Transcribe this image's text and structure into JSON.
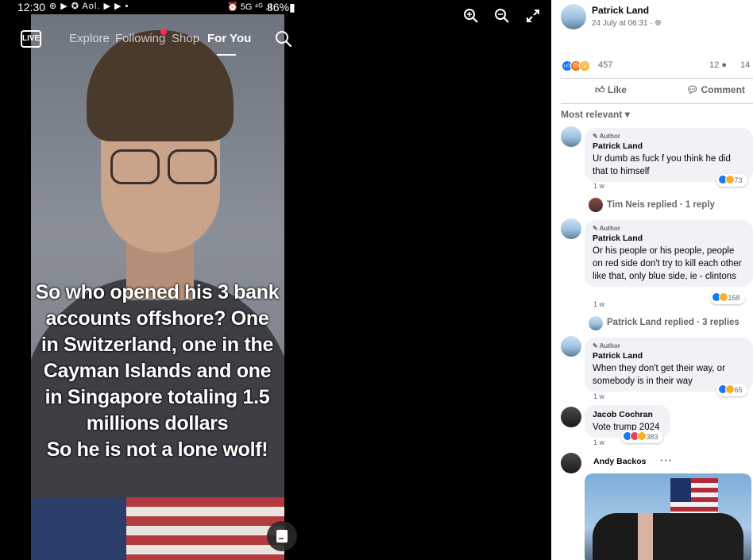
{
  "status_bar": {
    "time": "12:30",
    "app_icons": "⊛ ▶ ✪ Aol. ▶ ▶ •",
    "network": "⏰ 5G ⁴ᴳ .ıl",
    "battery": "86%▮"
  },
  "tiktok": {
    "live_label": "LIVE",
    "tabs": [
      "Explore",
      "Following",
      "Shop",
      "For You"
    ],
    "active_tab": "For You",
    "overlay_lines": [
      "So who opened his 3 bank",
      "accounts offshore? One",
      "in Switzerland, one in the",
      "Cayman Islands and one",
      "in Singapore totaling 1.5",
      "millions dollars",
      "So he is not a lone wolf!"
    ]
  },
  "viewer_controls": [
    "zoom-in-icon",
    "zoom-out-icon",
    "fullscreen-icon"
  ],
  "post": {
    "author": "Patrick Land",
    "time": "24 July at 06:31 · ",
    "privacy_icon": "globe-icon",
    "reactions_count": "457",
    "comments_count": "12",
    "shares_count": "14",
    "actions": {
      "like": "Like",
      "comment": "Comment"
    },
    "sort_label": "Most relevant"
  },
  "comments": [
    {
      "author_tag": "Author",
      "name": "Patrick Land",
      "text": "Ur dumb as fuck f you think he did that to himself",
      "reaction_count": "73",
      "time": "1 w",
      "replies": "Tim Neis replied · 1 reply"
    },
    {
      "author_tag": "Author",
      "name": "Patrick Land",
      "text": "Or his people or his people, people on red side don't try to kill each other like that, only blue side, ie - clintons",
      "reaction_count": "158",
      "time": "1 w",
      "replies": "Patrick Land replied · 3 replies"
    },
    {
      "author_tag": "Author",
      "name": "Patrick Land",
      "text": "When they don't get their way, or somebody is in their way",
      "reaction_count": "65",
      "time": "1 w"
    },
    {
      "name": "Jacob Cochran",
      "text": "Vote trump 2024",
      "reaction_count": "383",
      "time": "1 w"
    },
    {
      "name": "Andy Backos",
      "more": "···"
    }
  ],
  "colors": {
    "facebook_blue": "#1877f2",
    "tiktok_red": "#fe2c55",
    "muted_text": "#65676b",
    "bubble_bg": "#f0f2f5"
  }
}
